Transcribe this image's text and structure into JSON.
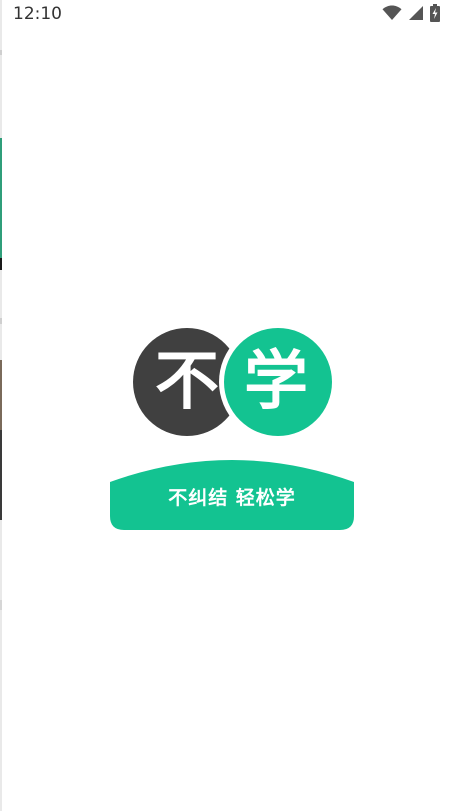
{
  "status_bar": {
    "time": "12:10",
    "icons": [
      "wifi-icon",
      "cellular-signal-icon",
      "battery-charging-icon"
    ]
  },
  "logo": {
    "char_left": "不",
    "char_right": "学",
    "slogan": "不纠结 轻松学"
  },
  "colors": {
    "brand_green": "#13c391",
    "dark_gray": "#404040",
    "background": "#ffffff"
  }
}
